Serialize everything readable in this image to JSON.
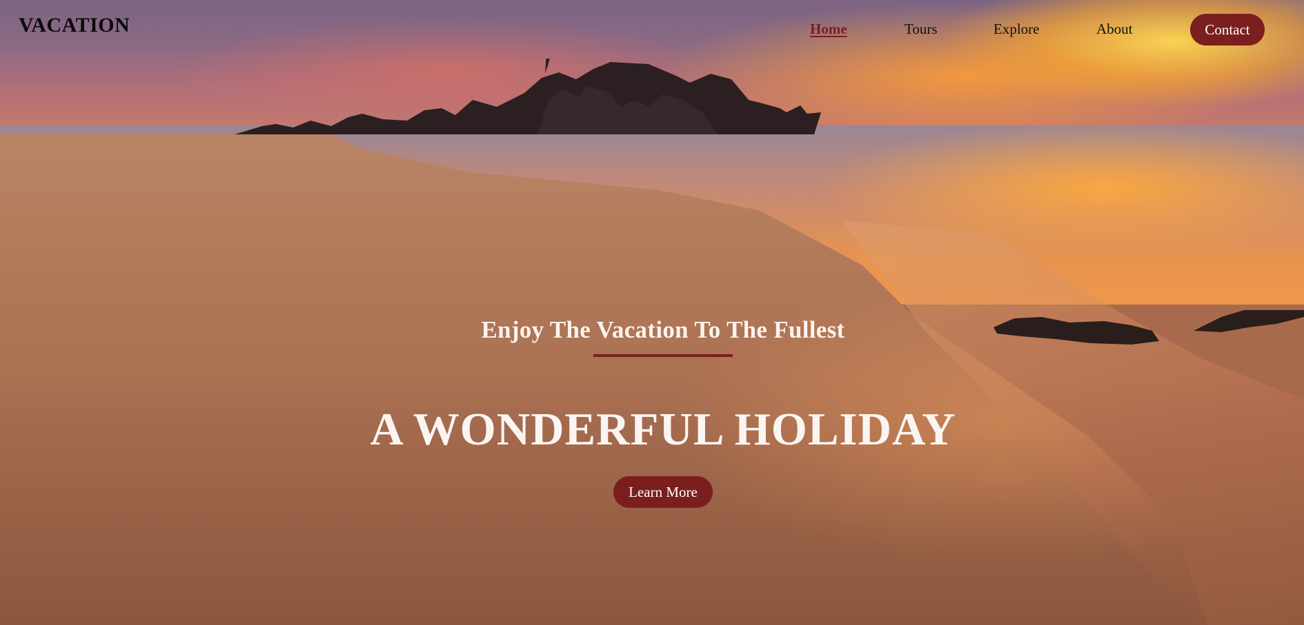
{
  "brand": {
    "logo": "VACATION"
  },
  "nav": {
    "items": [
      {
        "label": "Home",
        "active": true
      },
      {
        "label": "Tours",
        "active": false
      },
      {
        "label": "Explore",
        "active": false
      },
      {
        "label": "About",
        "active": false
      }
    ],
    "contact_label": "Contact"
  },
  "hero": {
    "tagline": "Enjoy The Vacation To The Fullest",
    "headline": "A WONDERFUL HOLIDAY",
    "cta_label": "Learn More",
    "background_image": "beach-sunset-photo"
  },
  "colors": {
    "accent": "#7a1e1e",
    "hero_text": "#fbf5f2",
    "nav_text": "#101010"
  }
}
